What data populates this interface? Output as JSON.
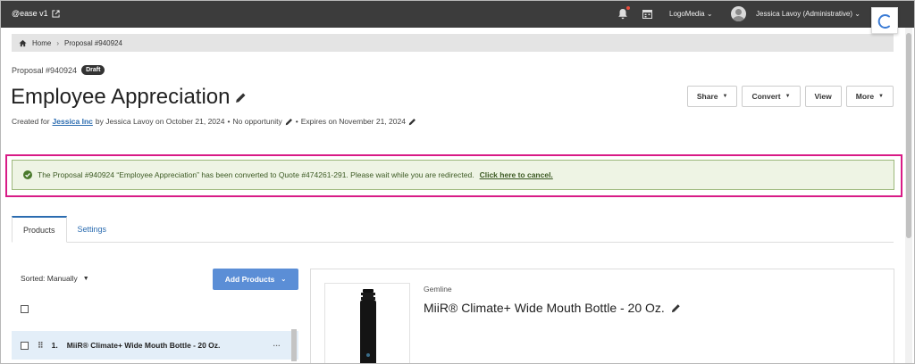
{
  "topbar": {
    "brand": "@ease v1",
    "org_menu": "LogoMedia",
    "user_menu": "Jessica Lavoy (Administrative)"
  },
  "breadcrumb": {
    "home": "Home",
    "separator": "›",
    "current": "Proposal #940924"
  },
  "header": {
    "proposal_label": "Proposal #940924",
    "status_badge": "Draft",
    "title": "Employee Appreciation",
    "meta_created_for": "Created for",
    "meta_client": "Jessica Inc",
    "meta_by": "by Jessica Lavoy on October 21, 2024",
    "meta_bullet": "•",
    "meta_opportunity": "No opportunity",
    "meta_expires": "Expires on November 21, 2024"
  },
  "actions": {
    "share": "Share",
    "convert": "Convert",
    "view": "View",
    "more": "More"
  },
  "alert": {
    "message": "The Proposal #940924 “Employee Appreciation” has been converted to Quote #474261-291. Please wait while you are redirected.",
    "cancel_link": "Click here to cancel."
  },
  "tabs": [
    {
      "label": "Products",
      "active": true
    },
    {
      "label": "Settings",
      "active": false
    }
  ],
  "products_panel": {
    "sort_label": "Sorted: Manually",
    "add_button": "Add Products",
    "items": [
      {
        "number": "1.",
        "name": "MiiR® Climate+ Wide Mouth Bottle - 20 Oz."
      }
    ]
  },
  "product_detail": {
    "supplier": "Gemline",
    "name": "MiiR® Climate+ Wide Mouth Bottle - 20 Oz."
  },
  "colors": {
    "topbar_bg": "#3c3c3c",
    "accent_blue": "#2b6cb0",
    "add_button": "#5b8ed6",
    "alert_bg": "#eef4e4",
    "highlight": "#d81b86"
  }
}
